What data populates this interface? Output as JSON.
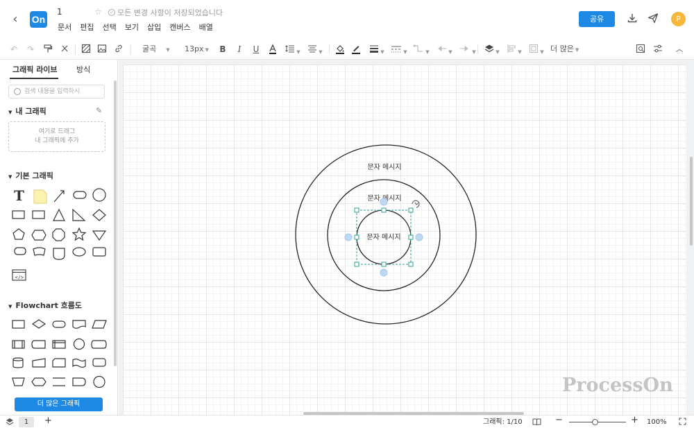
{
  "header": {
    "app_logo": "On",
    "doc_title": "1",
    "save_status": "모든 변경 사항이 저장되었습니다",
    "menu": [
      "문서",
      "편집",
      "선택",
      "보기",
      "삽입",
      "캔버스",
      "배열"
    ],
    "share_label": "공유",
    "avatar_letter": "P"
  },
  "toolbar": {
    "font_name": "굴곡",
    "font_size": "13px",
    "more_label": "더 많은"
  },
  "sidebar": {
    "tabs": [
      "그래픽 라이브",
      "방식"
    ],
    "search_placeholder": "검색 내용을 입력하시",
    "my_graphics_title": "내 그래픽",
    "drop_zone_line1": "여기로 드래그",
    "drop_zone_line2": "내 그래픽에 추가",
    "basic_title": "기본 그래픽",
    "flowchart_title": "Flowchart 흐름도",
    "more_button": "더 많은 그래픽"
  },
  "canvas": {
    "circles": [
      {
        "label": "문자 메시지"
      },
      {
        "label": "문자 메시지"
      },
      {
        "label": "문자 메시지"
      }
    ],
    "watermark": "ProcessOn"
  },
  "statusbar": {
    "page_number": "1",
    "graphics_count": "그래픽: 1/10",
    "zoom": "100%"
  },
  "colors": {
    "accent": "#1e88e5",
    "avatar": "#f6b73c",
    "selection": "#2f9e91"
  }
}
